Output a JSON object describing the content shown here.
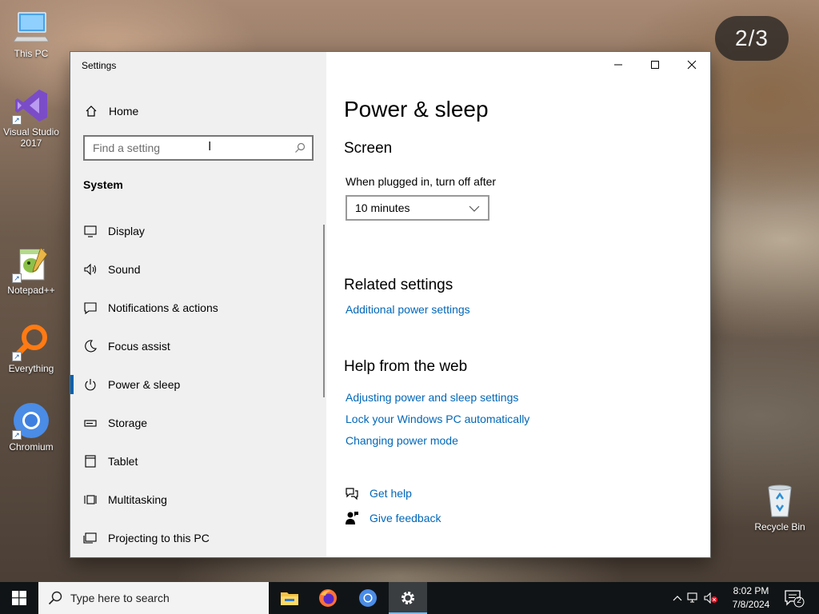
{
  "desktop": {
    "slide_counter": "2/3",
    "icons": [
      {
        "label": "This PC"
      },
      {
        "label": "Visual Studio 2017"
      },
      {
        "label": "Notepad++"
      },
      {
        "label": "Everything"
      },
      {
        "label": "Chromium"
      },
      {
        "label": "Recycle Bin"
      }
    ]
  },
  "window": {
    "title": "Settings",
    "sidebar": {
      "home_label": "Home",
      "search_placeholder": "Find a setting",
      "section_title": "System",
      "items": [
        {
          "label": "Display",
          "icon": "monitor-icon"
        },
        {
          "label": "Sound",
          "icon": "speaker-icon"
        },
        {
          "label": "Notifications & actions",
          "icon": "notification-icon"
        },
        {
          "label": "Focus assist",
          "icon": "moon-icon"
        },
        {
          "label": "Power & sleep",
          "icon": "power-icon",
          "active": true
        },
        {
          "label": "Storage",
          "icon": "storage-icon"
        },
        {
          "label": "Tablet",
          "icon": "tablet-icon"
        },
        {
          "label": "Multitasking",
          "icon": "multitasking-icon"
        },
        {
          "label": "Projecting to this PC",
          "icon": "projector-icon"
        }
      ]
    },
    "content": {
      "page_title": "Power & sleep",
      "screen_heading": "Screen",
      "plugged_in_label": "When plugged in, turn off after",
      "plugged_in_value": "10 minutes",
      "related_heading": "Related settings",
      "related_links": [
        "Additional power settings"
      ],
      "help_heading": "Help from the web",
      "help_links": [
        "Adjusting power and sleep settings",
        "Lock your Windows PC automatically",
        "Changing power mode"
      ],
      "get_help": "Get help",
      "give_feedback": "Give feedback"
    }
  },
  "taskbar": {
    "search_placeholder": "Type here to search",
    "time": "8:02 PM",
    "date": "7/8/2024",
    "notification_count": "2"
  },
  "colors": {
    "accent": "#0063b1",
    "link": "#0067b8",
    "taskbar": "#111416"
  }
}
